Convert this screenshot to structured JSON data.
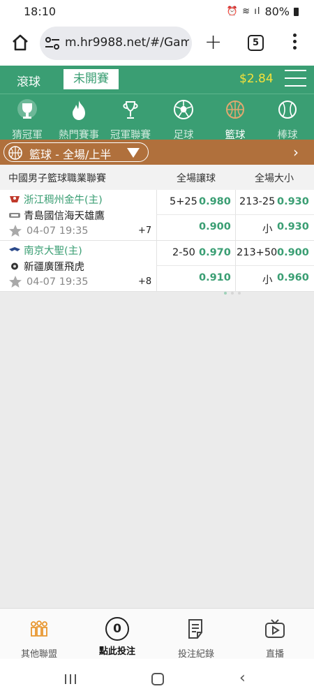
{
  "status_bar": {
    "time": "18:10",
    "battery": "80%"
  },
  "browser": {
    "url": "m.hr9988.net/#/Games",
    "tab_count": "5"
  },
  "header": {
    "live_label": "滾球",
    "upcoming_label": "未開賽",
    "balance": "$2.84"
  },
  "sports": [
    {
      "label": "猜冠軍",
      "icon": "trophy-icon"
    },
    {
      "label": "熱門賽事",
      "icon": "fire-icon"
    },
    {
      "label": "冠軍聯賽",
      "icon": "cup-icon"
    },
    {
      "label": "足球",
      "icon": "soccer-ball-icon"
    },
    {
      "label": "籃球",
      "icon": "basketball-icon",
      "active": true
    },
    {
      "label": "棒球",
      "icon": "baseball-icon"
    }
  ],
  "category": {
    "label": "籃球 - 全場/上半"
  },
  "table": {
    "league": "中國男子籃球職業聯賽",
    "col_handicap": "全場讓球",
    "col_total": "全場大小"
  },
  "matches": [
    {
      "home": "浙江稠州金牛(主)",
      "away": "青島國信海天雄鷹",
      "datetime": "04-07 19:35",
      "more": "+7",
      "handicap_line": "5+25",
      "handicap_home_odds": "0.980",
      "handicap_away_odds": "0.900",
      "total_line": "213-25",
      "total_over_odds": "0.930",
      "total_under_label": "小",
      "total_under_odds": "0.930"
    },
    {
      "home": "南京大聖(主)",
      "away": "新疆廣匯飛虎",
      "datetime": "04-07 19:35",
      "more": "+8",
      "handicap_line": "2-50",
      "handicap_home_odds": "0.970",
      "handicap_away_odds": "0.910",
      "total_line": "213+50",
      "total_over_odds": "0.900",
      "total_under_label": "小",
      "total_under_odds": "0.960"
    }
  ],
  "bottom_nav": {
    "other_leagues": "其他聯盟",
    "bet_count": "0",
    "bet_here": "點此投注",
    "bet_history": "投注紀錄",
    "live_stream": "直播"
  },
  "colors": {
    "brand_green": "#3a9e73",
    "category_brown": "#b0703c",
    "balance_yellow": "#f4e13a"
  }
}
